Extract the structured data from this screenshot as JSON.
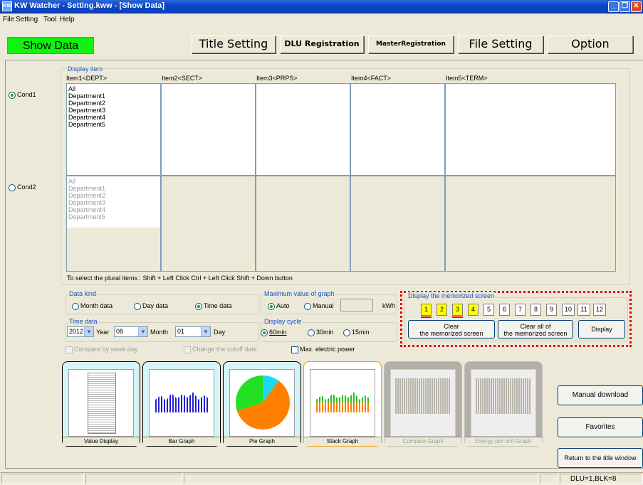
{
  "window": {
    "title": "KW Watcher - Setting.kww - [Show Data]",
    "icon_text": "KW"
  },
  "menu": [
    "File",
    "Setting",
    "Tool",
    "Help"
  ],
  "toolbar": {
    "show_data": "Show Data",
    "title_setting": "Title Setting",
    "dlu_registration": "DLU Registration",
    "master_registration": "MasterRegistration",
    "file_setting": "File Setting",
    "option": "Option"
  },
  "display_item": {
    "legend": "Display item",
    "headers": [
      "Item1<DEPT>",
      "Item2<SECT>",
      "Item3<PRPS>",
      "Item4<FACT>",
      "Item5<TERM>"
    ],
    "cond1_label": "Cond1",
    "cond2_label": "Cond2",
    "cond1_items": [
      "All",
      "Department1",
      "Department2",
      "Department3",
      "Department4",
      "Department5"
    ],
    "cond2_items": [
      "All",
      "Department1",
      "Department2",
      "Department3",
      "Department4",
      "Department5"
    ],
    "hint": "To select the plural items : Shift + Left Click  Ctrl + Left Click  Shift + Down button"
  },
  "data_kind": {
    "legend": "Data kind",
    "options": [
      "Month data",
      "Day data",
      "Time data"
    ],
    "selected": "Time data"
  },
  "time_data": {
    "legend": "Time data",
    "year_value": "2012",
    "year_label": "Year",
    "month_value": "08",
    "month_label": "Month",
    "day_value": "01",
    "day_label": "Day"
  },
  "max_value": {
    "legend": "Maximum value of graph",
    "options": [
      "Auto",
      "Manual"
    ],
    "selected": "Auto",
    "unit": "kWh",
    "manual_value": ""
  },
  "display_cycle": {
    "legend": "Display cycle",
    "options": [
      "60min",
      "30min",
      "15min"
    ],
    "selected": "60min"
  },
  "checkboxes": {
    "compare_by_week_day": "Compare by week day",
    "change_cutoff_date": "Change the cutoff date",
    "max_electric_power": "Max. electric power"
  },
  "memorized": {
    "legend": "Display the memorized screen",
    "slots": [
      "1",
      "2",
      "3",
      "4",
      "5",
      "6",
      "7",
      "8",
      "9",
      "10",
      "11",
      "12"
    ],
    "filled_slots": [
      1,
      2,
      3,
      4
    ],
    "underlined_slots": [
      1,
      3
    ],
    "clear_line1": "Clear",
    "clear_line2": "the memorized screen",
    "clear_all_line1": "Clear all of",
    "clear_all_line2": "the memorized screen",
    "display": "Display"
  },
  "graphs": [
    {
      "label": "Value Display",
      "enabled": true
    },
    {
      "label": "Bar Graph",
      "enabled": true
    },
    {
      "label": "Pie Graph",
      "enabled": true
    },
    {
      "label": "Stack Graph",
      "enabled": true
    },
    {
      "label": "Compare Graph",
      "enabled": false
    },
    {
      "label": "Energy per unit Graph",
      "enabled": false
    }
  ],
  "side_buttons": {
    "manual_download": "Manual download",
    "favorites": "Favorites",
    "return_title": "Return to the title window"
  },
  "status": {
    "right": "DLU=1,BLK=8"
  },
  "colors": {
    "show_data_bg": "#13f113",
    "highlight_yellow": "#ffff00",
    "red_dots": "#ff0000",
    "pie_orange": "#ff8000",
    "pie_green": "#22e022",
    "pie_cyan": "#22d8f0",
    "bar_blue": "#2020d0"
  }
}
